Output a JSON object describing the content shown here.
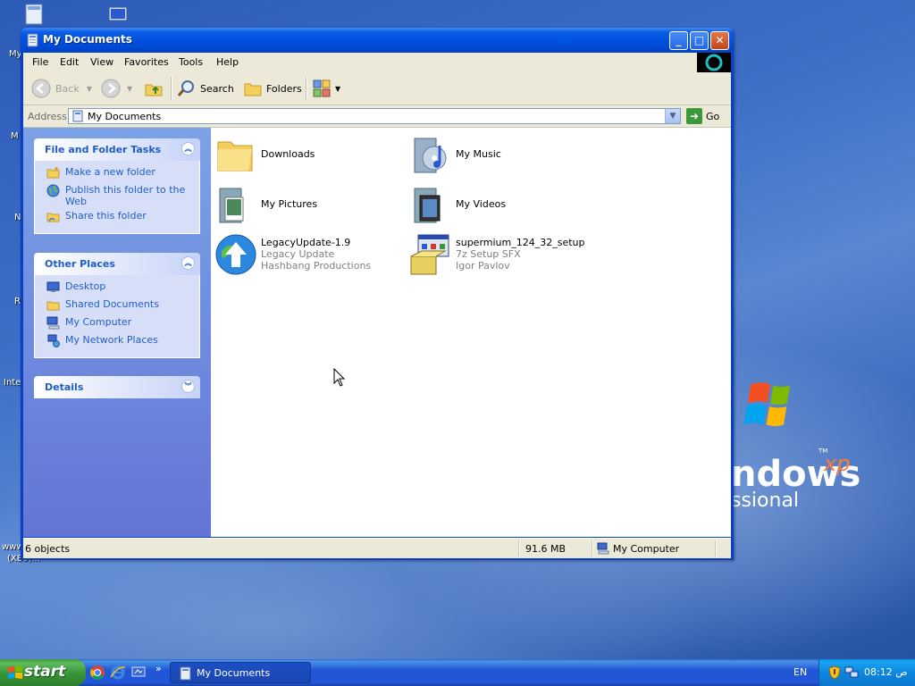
{
  "desktop": {
    "fragments": [
      "My",
      "M",
      "N",
      "R",
      "Inte",
      "www",
      "(X86)..."
    ],
    "logo": {
      "windows_text": "ndows",
      "xp_text": "xp",
      "tm_text": "TM",
      "edition_text": "ssional"
    }
  },
  "window": {
    "title": "My Documents",
    "controls": {
      "minimize": "_",
      "maximize": "□",
      "close": "✕"
    }
  },
  "menu": [
    "File",
    "Edit",
    "View",
    "Favorites",
    "Tools",
    "Help"
  ],
  "toolbar": {
    "back_label": "Back",
    "search_label": "Search",
    "folders_label": "Folders"
  },
  "address": {
    "label": "Address",
    "value": "My Documents",
    "go_label": "Go"
  },
  "panels": {
    "tasks": {
      "title": "File and Folder Tasks",
      "items": [
        "Make a new folder",
        "Publish this folder to the Web",
        "Share this folder"
      ]
    },
    "places": {
      "title": "Other Places",
      "items": [
        "Desktop",
        "Shared Documents",
        "My Computer",
        "My Network Places"
      ]
    },
    "details": {
      "title": "Details"
    }
  },
  "files": [
    {
      "name": "Downloads"
    },
    {
      "name": "My Music"
    },
    {
      "name": "My Pictures"
    },
    {
      "name": "My Videos"
    },
    {
      "name": "LegacyUpdate-1.9",
      "line2": "Legacy Update",
      "line3": "Hashbang Productions"
    },
    {
      "name": "supermium_124_32_setup",
      "line2": "7z Setup SFX",
      "line3": "Igor Pavlov"
    }
  ],
  "status": {
    "count": "6 objects",
    "size": "91.6 MB",
    "location": "My Computer"
  },
  "taskbar": {
    "start_label": "start",
    "chevron": "»",
    "window_button": "My Documents",
    "language": "EN",
    "clock": "08:12 ص"
  },
  "colors": {
    "title_blue": "#0054e3",
    "link_blue": "#215dc6",
    "start_green": "#3c9a3c",
    "tray_blue": "#0c8fe8"
  }
}
